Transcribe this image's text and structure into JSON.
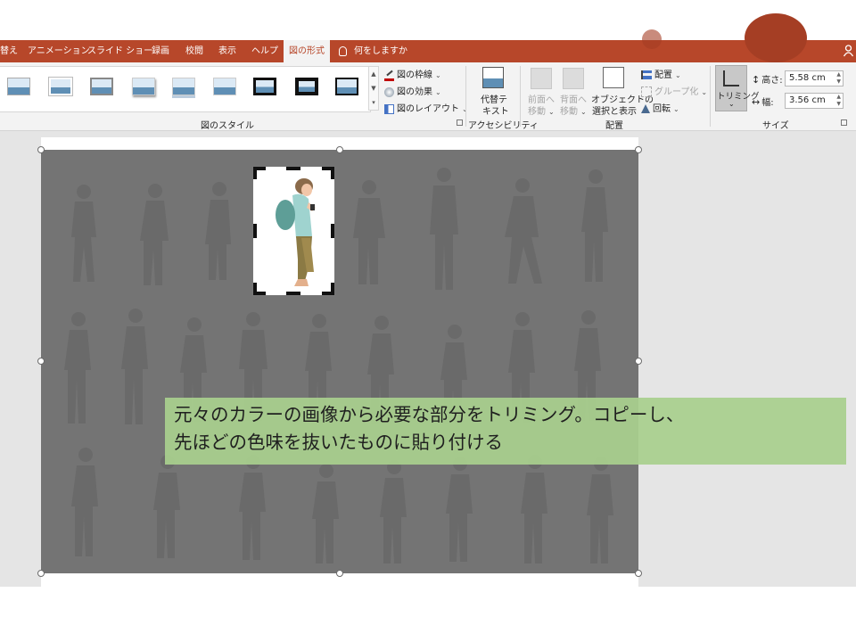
{
  "colors": {
    "accent": "#b7472a",
    "caption_bg": "#a9d08e",
    "photo_gray": "#747474"
  },
  "tabs": [
    {
      "label": "替え",
      "active": false
    },
    {
      "label": "アニメーション",
      "active": false
    },
    {
      "label": "スライド ショー",
      "active": false
    },
    {
      "label": "録画",
      "active": false
    },
    {
      "label": "校閲",
      "active": false
    },
    {
      "label": "表示",
      "active": false
    },
    {
      "label": "ヘルプ",
      "active": false
    },
    {
      "label": "図の形式",
      "active": true
    }
  ],
  "tell_me": {
    "icon": "lightbulb-icon",
    "label": "何をしますか"
  },
  "ribbon": {
    "picture_styles": {
      "label": "図のスタイル",
      "border": "図の枠線",
      "effects": "図の効果",
      "layout": "図のレイアウト"
    },
    "accessibility": {
      "label": "アクセシビリティ",
      "alt_text_line1": "代替テ",
      "alt_text_line2": "キスト"
    },
    "arrange": {
      "label": "配置",
      "bring_forward_line1": "前面へ",
      "bring_forward_line2": "移動",
      "send_backward_line1": "背面へ",
      "send_backward_line2": "移動",
      "selection_pane_line1": "オブジェクトの",
      "selection_pane_line2": "選択と表示",
      "align": "配置",
      "group": "グループ化",
      "rotate": "回転"
    },
    "size": {
      "label": "サイズ",
      "crop": "トリミング",
      "height_label": "高さ:",
      "height_value": "5.58 cm",
      "width_label": "幅:",
      "width_value": "3.56 cm"
    }
  },
  "slide": {
    "caption": "元々のカラーの画像から必要な部分をトリミング。コピーし、\n先ほどの色味を抜いたものに貼り付ける"
  }
}
